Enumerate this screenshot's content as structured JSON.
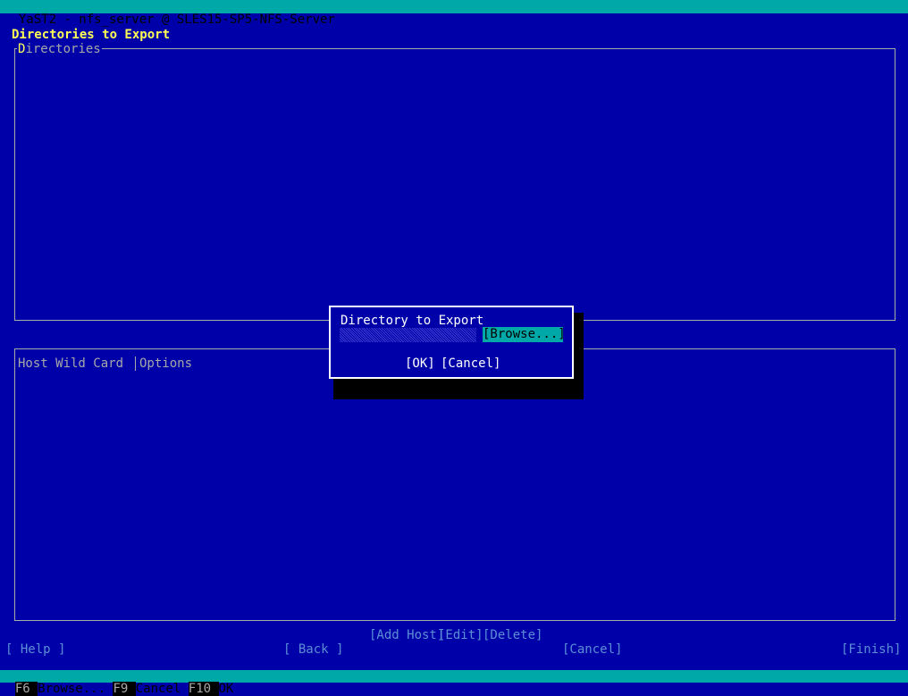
{
  "window": {
    "title": "YaST2 - nfs_server @ SLES15-SP5-NFS-Server"
  },
  "page": {
    "heading": "Directories to Export"
  },
  "directories_frame": {
    "label": "Directories"
  },
  "hosts_table": {
    "columns": [
      "Host Wild Card",
      "Options"
    ]
  },
  "table_buttons": {
    "add_host": "[Add Host]",
    "edit": "[Edit]",
    "delete": "[Delete]"
  },
  "bottom_buttons": {
    "help": "[ Help ]",
    "back": "[ Back ]",
    "cancel": "[Cancel]",
    "finish": "[Finish]"
  },
  "dialog": {
    "label": "Directory to Export",
    "input_value": "",
    "browse": "[Browse...]",
    "ok": "[OK]",
    "cancel": "[Cancel]"
  },
  "function_keys": [
    {
      "key": "F6",
      "label": "Browse..."
    },
    {
      "key": "F9",
      "label": "Cancel"
    },
    {
      "key": "F10",
      "label": "OK"
    }
  ],
  "colors": {
    "background": "#0000a8",
    "titlebar": "#00a8a8",
    "heading": "#ffff54",
    "hotkey": "#ffff54"
  }
}
